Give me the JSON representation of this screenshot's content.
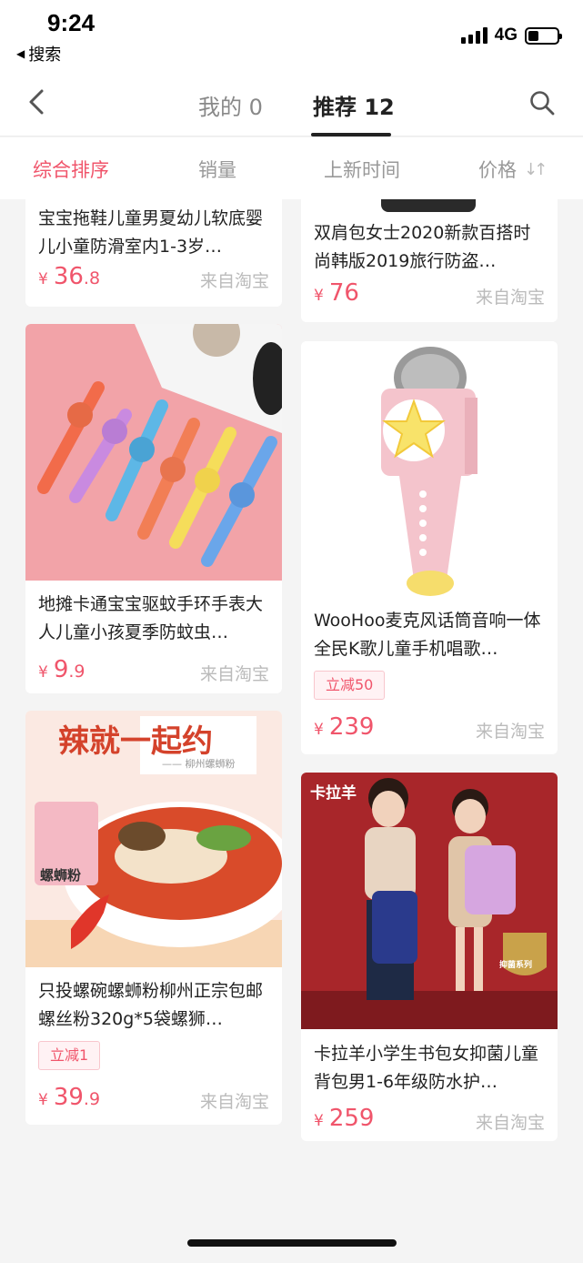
{
  "status": {
    "time": "9:24",
    "back_app": "搜索",
    "network": "4G",
    "battery_level": 0.35
  },
  "nav": {
    "tabs": [
      {
        "label": "我的 0"
      },
      {
        "label": "推荐 12"
      }
    ],
    "active_tab": 1
  },
  "sort": {
    "items": [
      {
        "label": "综合排序",
        "active": true
      },
      {
        "label": "销量"
      },
      {
        "label": "上新时间"
      },
      {
        "label": "价格"
      }
    ]
  },
  "products": [
    {
      "title": "宝宝拖鞋儿童男夏幼儿软底婴儿小童防滑室内1-3岁…",
      "price_int": "36",
      "price_dec": ".8",
      "currency": "¥",
      "source": "来自淘宝"
    },
    {
      "title": "双肩包女士2020新款百搭时尚韩版2019旅行防盗…",
      "price_int": "76",
      "price_dec": "",
      "currency": "¥",
      "source": "来自淘宝"
    },
    {
      "title": "地摊卡通宝宝驱蚊手环手表大人儿童小孩夏季防蚊虫…",
      "price_int": "9",
      "price_dec": ".9",
      "currency": "¥",
      "source": "来自淘宝"
    },
    {
      "title": "WooHoo麦克风话筒音响一体全民K歌儿童手机唱歌…",
      "price_int": "239",
      "price_dec": "",
      "currency": "¥",
      "source": "来自淘宝",
      "tag": "立减50"
    },
    {
      "title": "只投螺碗螺蛳粉柳州正宗包邮螺丝粉320g*5袋螺狮…",
      "price_int": "39",
      "price_dec": ".9",
      "currency": "¥",
      "source": "来自淘宝",
      "tag": "立减1",
      "image_text": {
        "banner": "辣就一起约",
        "sub": "—— 柳州螺蛳粉",
        "pack": "螺蛳粉"
      }
    },
    {
      "title": "卡拉羊小学生书包女抑菌儿童背包男1-6年级防水护…",
      "price_int": "259",
      "price_dec": "",
      "currency": "¥",
      "source": "来自淘宝",
      "image_text": {
        "brand": "卡拉羊",
        "badge": "抑菌系列"
      }
    }
  ],
  "colors": {
    "accent": "#f0556b",
    "muted": "#bbbbbb"
  }
}
